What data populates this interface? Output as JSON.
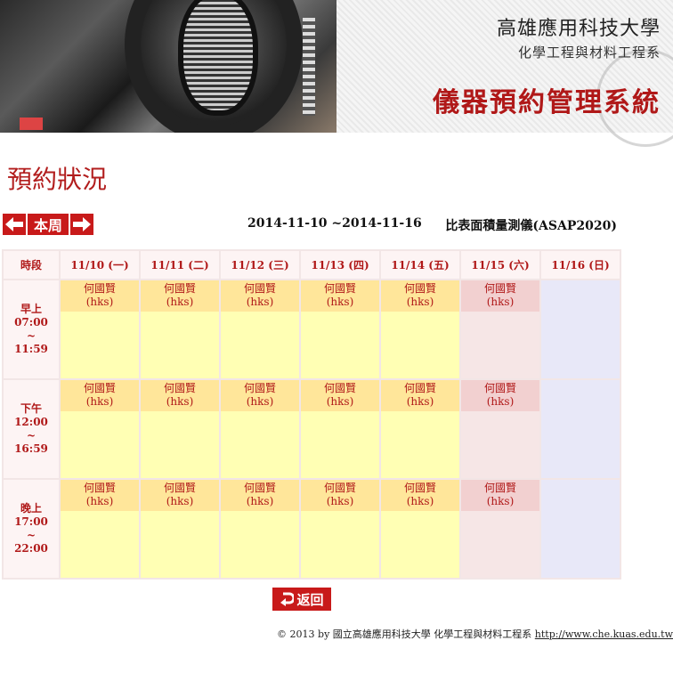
{
  "header": {
    "university": "高雄應用科技大學",
    "department": "化學工程與材料工程系",
    "system_title": "儀器預約管理系統"
  },
  "page_title": "預約狀況",
  "toolbar": {
    "prev_icon": "arrow-left-icon",
    "week_label": "本周",
    "next_icon": "arrow-right-icon",
    "date_range": "2014-11-10 ~2014-11-16",
    "instrument": "比表面積量測儀(ASAP2020)"
  },
  "table": {
    "corner": "時段",
    "days": [
      "11/10 (一)",
      "11/11 (二)",
      "11/12 (三)",
      "11/13 (四)",
      "11/14 (五)",
      "11/15 (六)",
      "11/16 (日)"
    ],
    "periods": [
      {
        "name": "早上",
        "start": "07:00",
        "sep": "~",
        "end": "11:59"
      },
      {
        "name": "下午",
        "start": "12:00",
        "sep": "~",
        "end": "16:59"
      },
      {
        "name": "晚上",
        "start": "17:00",
        "sep": "~",
        "end": "22:00"
      }
    ],
    "booking": {
      "user": "何國賢",
      "id": "(hks)"
    }
  },
  "back_label": "返回",
  "footer": {
    "text": "© 2013 by 國立高雄應用科技大學 化學工程與材料工程系",
    "url": "http://www.che.kuas.edu.tw"
  },
  "colors": {
    "accent": "#c81a1a",
    "weekday_slot": "#ffffb4",
    "booking_bg": "#ffe69a",
    "saturday_slot": "#f6e6e6",
    "sunday_slot": "#e8e8f8"
  }
}
